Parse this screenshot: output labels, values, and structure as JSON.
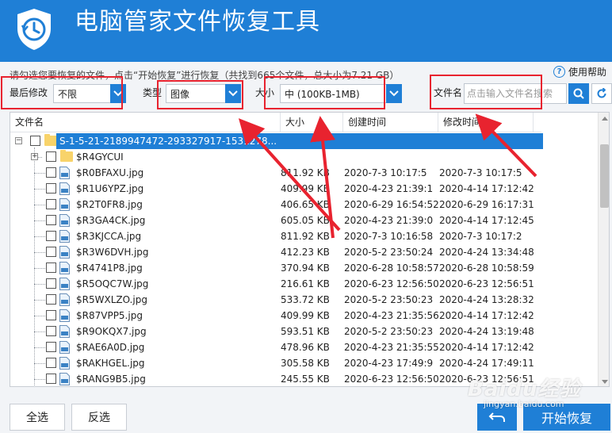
{
  "app": {
    "title": "电脑管家文件恢复工具"
  },
  "instruction": "请勾选您要恢复的文件，点击“开始恢复”进行恢复（共找到665个文件，总大小为7.21 GB）",
  "help_label": "使用帮助",
  "filters": {
    "modified_label": "最后修改",
    "modified_value": "不限",
    "type_label": "类型",
    "type_value": "图像",
    "size_label": "大小",
    "size_value": "中 (100KB-1MB)",
    "filename_label": "文件名",
    "search_placeholder": "点击输入文件名搜索"
  },
  "table": {
    "columns": [
      "文件名",
      "大小",
      "创建时间",
      "修改时间"
    ],
    "root": "S-1-5-21-2189947472-293327917-1531278...",
    "folder": "$R4GYCUI",
    "rows": [
      {
        "name": "$R0BFAXU.jpg",
        "size": "811.92 KB",
        "created": "2020-7-3 10:17:5",
        "modified": "2020-7-3 10:17:5"
      },
      {
        "name": "$R1U6YPZ.jpg",
        "size": "409.99 KB",
        "created": "2020-4-23 21:39:1",
        "modified": "2020-4-14 17:12:42"
      },
      {
        "name": "$R2T0FR8.jpg",
        "size": "406.65 KB",
        "created": "2020-6-29 16:54:52",
        "modified": "2020-6-29 16:17:31"
      },
      {
        "name": "$R3GA4CK.jpg",
        "size": "605.05 KB",
        "created": "2020-4-23 21:39:0",
        "modified": "2020-4-14 17:12:45"
      },
      {
        "name": "$R3KJCCA.jpg",
        "size": "811.92 KB",
        "created": "2020-7-3 10:16:58",
        "modified": "2020-7-3 10:17:2"
      },
      {
        "name": "$R3W6DVH.jpg",
        "size": "412.23 KB",
        "created": "2020-5-2 23:50:24",
        "modified": "2020-4-24 13:34:48"
      },
      {
        "name": "$R4741P8.jpg",
        "size": "370.94 KB",
        "created": "2020-6-28 10:58:57",
        "modified": "2020-6-28 10:58:59"
      },
      {
        "name": "$R5OQC7W.jpg",
        "size": "216.61 KB",
        "created": "2020-6-23 12:56:50",
        "modified": "2020-6-23 12:56:51"
      },
      {
        "name": "$R5WXLZO.jpg",
        "size": "533.72 KB",
        "created": "2020-5-2 23:50:23",
        "modified": "2020-4-24 13:28:32"
      },
      {
        "name": "$R87VPP5.jpg",
        "size": "409.99 KB",
        "created": "2020-4-23 21:35:56",
        "modified": "2020-4-14 17:12:42"
      },
      {
        "name": "$R9OKQX7.jpg",
        "size": "593.51 KB",
        "created": "2020-5-2 23:50:23",
        "modified": "2020-4-24 13:19:48"
      },
      {
        "name": "$RAE6A0D.jpg",
        "size": "478.96 KB",
        "created": "2020-4-23 21:35:55",
        "modified": "2020-4-14 17:12:42"
      },
      {
        "name": "$RAKHGEL.jpg",
        "size": "305.58 KB",
        "created": "2020-4-23 17:49:9",
        "modified": "2020-4-24 17:49:11"
      },
      {
        "name": "$RANG9B5.jpg",
        "size": "245.55 KB",
        "created": "2020-6-23 12:56:50",
        "modified": "2020-6-23 12:56:51"
      }
    ]
  },
  "buttons": {
    "select_all": "全选",
    "invert": "反选",
    "start": "开始恢复"
  },
  "watermark": {
    "main": "Baidu经验",
    "sub": "jingyan.baidu.com"
  },
  "colors": {
    "brand": "#1f7fd6",
    "annotation": "#e8232f"
  }
}
